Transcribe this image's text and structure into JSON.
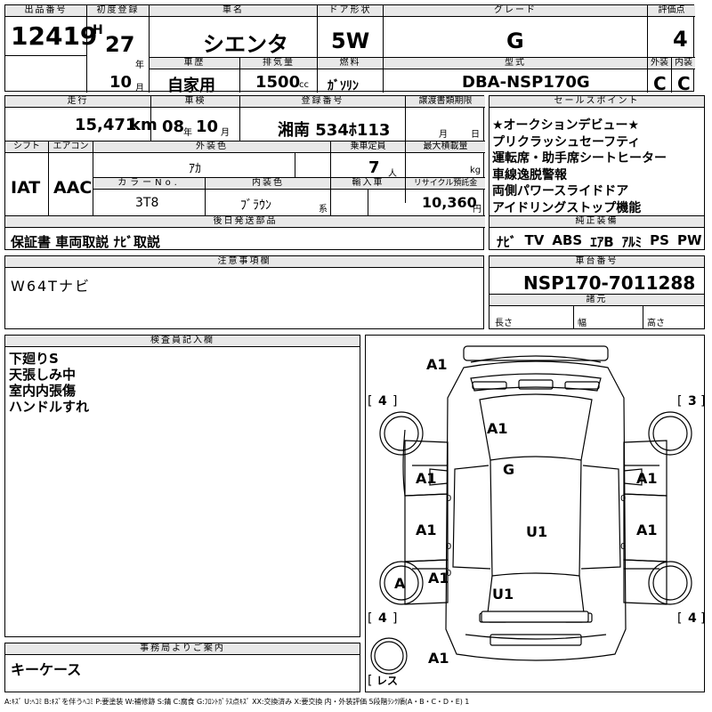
{
  "header": {
    "lot_label": "出品番号",
    "lot_value": "12419",
    "first_reg_label": "初度登録",
    "era": "H",
    "year": "27",
    "year_unit": "年",
    "month": "10",
    "month_unit": "月",
    "car_name_label": "車名",
    "car_name": "シエンタ",
    "door_label": "ドア形状",
    "door": "5W",
    "grade_label": "グレード",
    "grade": "G",
    "score_label": "評価点",
    "score": "4",
    "history_label": "車歴",
    "history": "自家用",
    "displacement_label": "排気量",
    "displacement": "1500",
    "cc": "cc",
    "fuel_label": "燃料",
    "fuel": "ｶﾞｿﾘﾝ",
    "model_label": "型式",
    "model": "DBA-NSP170G",
    "exterior_label": "外装",
    "exterior": "C",
    "interior_label": "内装",
    "interior": "C"
  },
  "row2": {
    "mileage_label": "走行",
    "mileage": "15,471",
    "km": "km",
    "inspection_label": "車検",
    "insp_year": "08",
    "insp_year_unit": "年",
    "insp_month": "10",
    "insp_month_unit": "月",
    "plate_label": "登録番号",
    "plate": "湘南 534ﾎ113",
    "transfer_label": "譲渡書類期限",
    "transfer_month": "月",
    "transfer_day": "日",
    "shift_label": "シフト",
    "shift": "IAT",
    "ac_label": "エアコン",
    "ac": "AAC",
    "ext_color_label": "外装色",
    "ext_color": "ｱｶ",
    "capacity_label": "乗車定員",
    "capacity": "7",
    "capacity_unit": "人",
    "load_label": "最大積載量",
    "load_unit": "kg",
    "color_no_label": "カラーNo.",
    "color_no": "3T8",
    "int_color_label": "内装色",
    "int_color": "ﾌﾞﾗｳﾝ",
    "int_color_unit": "系",
    "import_label": "輸入車",
    "recycle_label": "リサイクル預託金",
    "recycle": "10,360",
    "yen": "円",
    "later_label": "後日発送部品",
    "later": "保証書 車両取説 ﾅﾋﾞ取説"
  },
  "sales": {
    "label": "セールスポイント",
    "lines": [
      "★オークションデビュー★",
      "プリクラッシュセーフティ",
      "運転席・助手席シートヒーター",
      "車線逸脱警報",
      "両側パワースライドドア",
      "アイドリングストップ機能"
    ]
  },
  "equipment": {
    "label": "純正装備",
    "items": [
      "ﾅﾋﾞ",
      "TV",
      "ABS",
      "ｴｱB",
      "ｱﾙﾐ",
      "PS",
      "PW"
    ]
  },
  "notes": {
    "label": "注意事項欄",
    "text": "W64Tナビ"
  },
  "chassis": {
    "label": "車台番号",
    "value": "NSP170-7011288",
    "dims_label": "諸元",
    "length": "長さ",
    "width": "幅",
    "height": "高さ"
  },
  "inspector": {
    "label": "検査員記入欄",
    "lines": [
      "下廻りS",
      "天張しみ中",
      "室内内張傷",
      "ハンドルすれ"
    ]
  },
  "office": {
    "label": "事務局よりご案内",
    "text": "キーケース"
  },
  "diagram": {
    "marks": [
      "A1",
      "A1",
      "G",
      "A1",
      "A1",
      "U1",
      "A1",
      "A1",
      "A",
      "A1",
      "U1",
      "A1"
    ],
    "zero": "0",
    "tires": [
      "4",
      "3",
      "4",
      "4"
    ],
    "spare": "レス"
  },
  "legend": "A:ｷｽﾞ U:ﾍｺﾐ B:ｷｽﾞを伴うﾍｺﾐ P:要塗装 W:補修跡 S:錆 C:腐食 G:ﾌﾛﾝﾄｶﾞﾗｽ点ｷｽﾞ XX:交換済み X:要交換 内・外装評価 5段階ﾗﾝｸ順(A・B・C・D・E) 1"
}
